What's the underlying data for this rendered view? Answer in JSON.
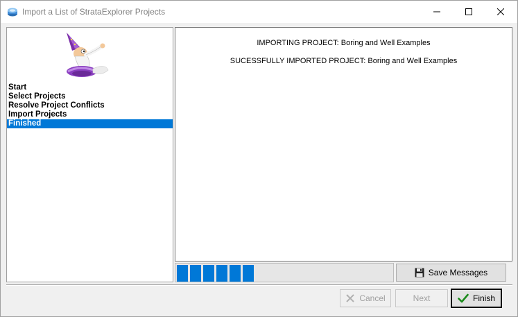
{
  "window": {
    "title": "Import a List of StrataExplorer Projects",
    "icon": "strataexplorer-app-icon"
  },
  "steps": [
    {
      "label": "Start",
      "selected": false
    },
    {
      "label": "Select Projects",
      "selected": false
    },
    {
      "label": "Resolve Project Conflicts",
      "selected": false
    },
    {
      "label": "Import Projects",
      "selected": false
    },
    {
      "label": "Finished",
      "selected": true
    }
  ],
  "messages": [
    "IMPORTING PROJECT: Boring and Well Examples",
    "SUCESSFULLY IMPORTED PROJECT: Boring and Well Examples"
  ],
  "progress": {
    "filled_segments": 6
  },
  "buttons": {
    "save_messages": "Save Messages",
    "cancel": "Cancel",
    "next": "Next",
    "finish": "Finish"
  },
  "colors": {
    "accent": "#0078d7",
    "finish_check": "#1a8a1a"
  }
}
